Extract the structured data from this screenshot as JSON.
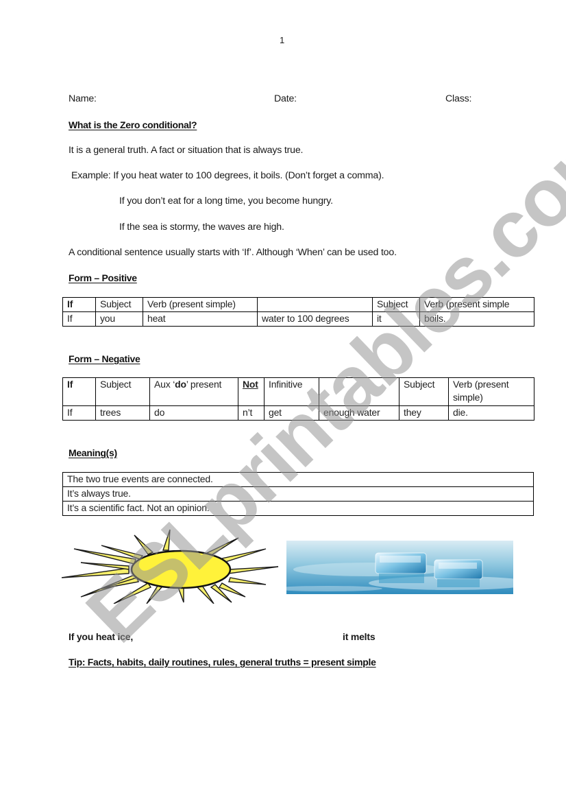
{
  "page_number": "1",
  "header": {
    "name_label": "Name:",
    "date_label": "Date:",
    "class_label": "Class:"
  },
  "intro": {
    "heading": "What is the Zero conditional?",
    "definition": "It is a general truth. A fact or situation that is always true.",
    "example_line": "Example: If you heat water to 100 degrees, it boils. (Don’t forget a comma).",
    "example_2": "If you don’t eat for a long time, you become hungry.",
    "example_3": "If the sea is stormy, the waves are high.",
    "note": "A conditional sentence usually starts with ‘If’. Although ‘When’ can be used too."
  },
  "positive": {
    "heading": "Form – Positive",
    "header_row": [
      "If",
      "Subject",
      "Verb (present simple)",
      "",
      "Subject",
      "Verb (present simple"
    ],
    "example_row": [
      "If",
      "you",
      "heat",
      "water to 100 degrees",
      "it",
      "boils."
    ]
  },
  "negative": {
    "heading": "Form – Negative",
    "header_row": {
      "if": "If",
      "subject": "Subject",
      "aux_prefix": "Aux ‘",
      "aux_bold": "do",
      "aux_suffix": "’ present",
      "not": "Not",
      "infinitive": "Infinitive",
      "blank": "",
      "subject2": "Subject",
      "verb": "Verb (present simple)"
    },
    "example_row": [
      "If",
      "trees",
      "do",
      "n’t",
      "get",
      "enough water",
      "they",
      "die."
    ]
  },
  "meanings": {
    "heading": "Meaning(s)",
    "items": [
      "The two true events are connected.",
      "It’s always true.",
      "It’s a scientific fact. Not an opinion."
    ]
  },
  "images": {
    "sun": "sun-icon",
    "ice": "melting-ice-cubes-image"
  },
  "captions": {
    "left": "If you heat ice,",
    "right": "it melts"
  },
  "tip": "Tip: Facts, habits, daily routines, rules, general truths = present simple",
  "watermark": "ESLprintables.com",
  "colors": {
    "sun_fill": "#fff23a",
    "ice_blue": "#3a9cc8",
    "watermark_gray": "#a0a0a0"
  }
}
